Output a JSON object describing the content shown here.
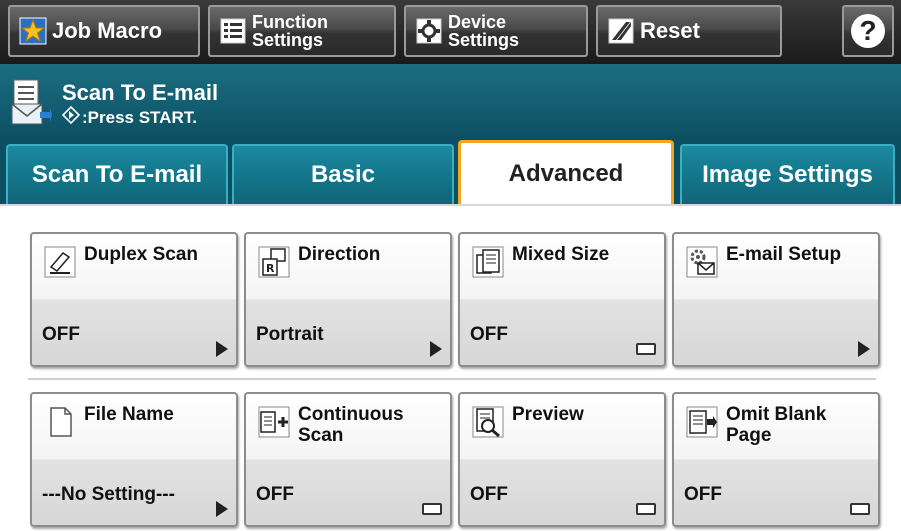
{
  "toolbar": {
    "job_macro": "Job Macro",
    "function_settings": [
      "Function",
      "Settings"
    ],
    "device_settings": [
      "Device",
      "Settings"
    ],
    "reset": "Reset",
    "help": "?"
  },
  "status": {
    "title": "Scan To E-mail",
    "message": ":Press START."
  },
  "tabs": [
    {
      "label": "Scan To E-mail",
      "active": false
    },
    {
      "label": "Basic",
      "active": false
    },
    {
      "label": "Advanced",
      "active": true
    },
    {
      "label": "Image Settings",
      "active": false
    }
  ],
  "functions": [
    {
      "name": "Duplex Scan",
      "value": "OFF",
      "icon": "duplex-scan-icon",
      "indicator": "arrow"
    },
    {
      "name": "Direction",
      "value": "Portrait",
      "icon": "direction-icon",
      "indicator": "arrow"
    },
    {
      "name": "Mixed Size",
      "value": "OFF",
      "icon": "mixed-size-icon",
      "indicator": "checkbox"
    },
    {
      "name": "E-mail Setup",
      "value": "",
      "icon": "email-setup-icon",
      "indicator": "arrow"
    },
    {
      "name": "File Name",
      "value": "---No Setting---",
      "icon": "file-name-icon",
      "indicator": "arrow"
    },
    {
      "name": "Continuous Scan",
      "value": "OFF",
      "icon": "continuous-scan-icon",
      "indicator": "checkbox"
    },
    {
      "name": "Preview",
      "value": "OFF",
      "icon": "preview-icon",
      "indicator": "checkbox"
    },
    {
      "name": "Omit Blank Page",
      "value": "OFF",
      "icon": "omit-blank-page-icon",
      "indicator": "checkbox"
    }
  ],
  "colors": {
    "header_teal": "#0d5164",
    "tab_teal": "#1a8aa0",
    "active_tab_border": "#f3a51c"
  }
}
